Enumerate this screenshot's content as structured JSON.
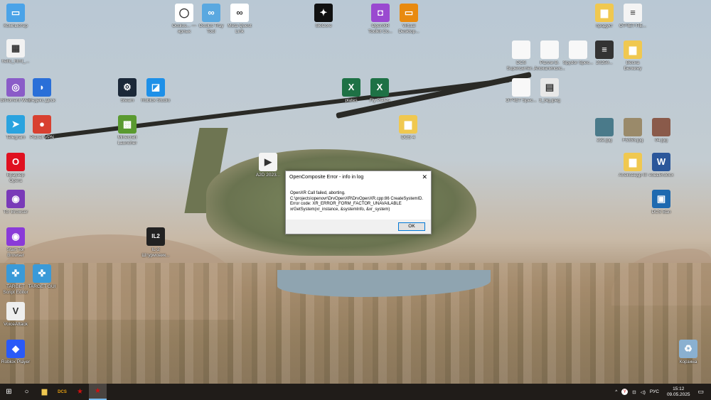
{
  "desktop": {
    "icons": [
      {
        "label": "Компьютер",
        "icon": "computer-icon",
        "color": "#4aa3e8",
        "glyph": "▭"
      },
      {
        "label": "hello_html_...",
        "icon": "image-file-icon",
        "color": "#f2f2f2",
        "glyph": "▦"
      },
      {
        "label": "BitTorrent Web",
        "icon": "bittorrent-icon",
        "color": "#8a5cc8",
        "glyph": "◎"
      },
      {
        "label": "Яндекс Диск",
        "icon": "yandex-disk-icon",
        "color": "#2a6fd8",
        "glyph": "◗"
      },
      {
        "label": "Steam",
        "icon": "steam-icon",
        "color": "#1b2838",
        "glyph": "⚙"
      },
      {
        "label": "Roblox Studio",
        "icon": "roblox-studio-icon",
        "color": "#1e90e8",
        "glyph": "◪"
      },
      {
        "label": "Telegram",
        "icon": "telegram-icon",
        "color": "#2aa3df",
        "glyph": "➤"
      },
      {
        "label": "Planet VPN",
        "icon": "planet-vpn-icon",
        "color": "#d84030",
        "glyph": "●"
      },
      {
        "label": "Minecraft Launcher",
        "icon": "minecraft-icon",
        "color": "#5a9a30",
        "glyph": "▩"
      },
      {
        "label": "Браузер Opera",
        "icon": "opera-icon",
        "color": "#e01020",
        "glyph": "O"
      },
      {
        "label": "Tor Browser",
        "icon": "folder-icon",
        "color": "#7a3ab8",
        "glyph": "◉"
      },
      {
        "label": "Start Tor Browser",
        "icon": "tor-icon",
        "color": "#8a3ad8",
        "glyph": "◉"
      },
      {
        "label": "TARGET Script Editor",
        "icon": "target-icon",
        "color": "#3a9ad8",
        "glyph": "✜"
      },
      {
        "label": "TARGET GUI",
        "icon": "target-gui-icon",
        "color": "#3a9ad8",
        "glyph": "✜"
      },
      {
        "label": "VoiceAttack",
        "icon": "voiceattack-icon",
        "color": "#eeeeee",
        "glyph": "V"
      },
      {
        "label": "Roblox Player",
        "icon": "roblox-icon",
        "color": "#2a5af8",
        "glyph": "◆"
      },
      {
        "label": "Oculus... — ярлык",
        "icon": "oculus-icon",
        "color": "#ffffff",
        "glyph": "◯"
      },
      {
        "label": "Oculus Tray Tool",
        "icon": "oculus-tray-icon",
        "color": "#5aa8e0",
        "glyph": "∞"
      },
      {
        "label": "Meta Quest Link",
        "icon": "meta-icon",
        "color": "#ffffff",
        "glyph": "∞"
      },
      {
        "label": "SkiCore",
        "icon": "app-icon",
        "color": "#111111",
        "glyph": "✦"
      },
      {
        "label": "OpenXR Toolkit Co...",
        "icon": "openxr-toolkit-icon",
        "color": "#9a4ad0",
        "glyph": "◘"
      },
      {
        "label": "Virtual Desktop...",
        "icon": "virtual-desktop-icon",
        "color": "#e88a10",
        "glyph": "▭"
      },
      {
        "label": "IL-2 Штурмовик...",
        "icon": "il2-icon",
        "color": "#222222",
        "glyph": "IL2"
      },
      {
        "label": "A2D 2023...",
        "icon": "video-file-icon",
        "color": "#f4f4f4",
        "glyph": "▶"
      },
      {
        "label": "plates",
        "icon": "excel-icon",
        "color": "#1e7145",
        "glyph": "X"
      },
      {
        "label": "Fly Plates",
        "icon": "excel-icon",
        "color": "#1e7145",
        "glyph": "X"
      },
      {
        "label": "DCS 4",
        "icon": "folder-icon",
        "color": "#f0c850",
        "glyph": "▆"
      },
      {
        "label": "продукт",
        "icon": "folder-icon",
        "color": "#f0c850",
        "glyph": "▆"
      },
      {
        "label": "ОТЧЁТ-ПЕ...",
        "icon": "text-file-icon",
        "color": "#f4f4f4",
        "glyph": "≡"
      },
      {
        "label": "DCS Supercarrier...",
        "icon": "file-icon",
        "color": "#f8f8f8",
        "glyph": ""
      },
      {
        "label": "Ралли В. Апокалипсис...",
        "icon": "file-icon",
        "color": "#f8f8f8",
        "glyph": ""
      },
      {
        "label": "Spydor Spec...",
        "icon": "file-icon",
        "color": "#f8f8f8",
        "glyph": ""
      },
      {
        "label": "20250...",
        "icon": "dark-file-icon",
        "color": "#333333",
        "glyph": "≡"
      },
      {
        "label": "Весна Белкину",
        "icon": "folder-icon",
        "color": "#f0c850",
        "glyph": "▆"
      },
      {
        "label": "ОТЧЁТ Spec...",
        "icon": "file-icon",
        "color": "#f8f8f8",
        "glyph": ""
      },
      {
        "label": "3_big.jpeg",
        "icon": "image-file-icon",
        "color": "#e8e8e8",
        "glyph": "▤"
      },
      {
        "label": "222.jpg",
        "icon": "image-file-icon",
        "color": "#4a7a8a",
        "glyph": ""
      },
      {
        "label": "F5353.jpg",
        "icon": "image-file-icon",
        "color": "#9a8a6a",
        "glyph": ""
      },
      {
        "label": "04.jpg",
        "icon": "image-file-icon",
        "color": "#8a5a4a",
        "glyph": ""
      },
      {
        "label": "Александр III",
        "icon": "folder-icon",
        "color": "#f0c850",
        "glyph": "▆"
      },
      {
        "label": "новый.docx",
        "icon": "word-icon",
        "color": "#2b579a",
        "glyph": "W"
      },
      {
        "label": "DCS Ban",
        "icon": "archive-icon",
        "color": "#1e6ab0",
        "glyph": "▣"
      },
      {
        "label": "Корзина",
        "icon": "recycle-bin-icon",
        "color": "#8ab0d0",
        "glyph": "♻"
      }
    ]
  },
  "dialog": {
    "title": "OpenComposite Error - info in log",
    "close": "✕",
    "lines": [
      "OpenXR Call failed, aborting.",
      "C:\\projects\\openovr\\DrvOpenXR\\DrvOpenXR.cpp:86 CreateSystemID.",
      "Error code: XR_ERROR_FORM_FACTOR_UNAVAILABLE",
      "xrGetSystem(xr_instance, &systemInfo, &xr_system)"
    ],
    "ok": "OK"
  },
  "taskbar": {
    "start": "⊞",
    "search": "○",
    "explorer": "▆",
    "dcs": "DCS",
    "app1": "★",
    "app2": "★",
    "tray": {
      "chevron": "^",
      "yandex": "Y",
      "network": "⊡",
      "volume": "◁)",
      "lang": "РУС",
      "time": "15:12",
      "date": "09.05.2025",
      "notifications": "▭"
    }
  }
}
